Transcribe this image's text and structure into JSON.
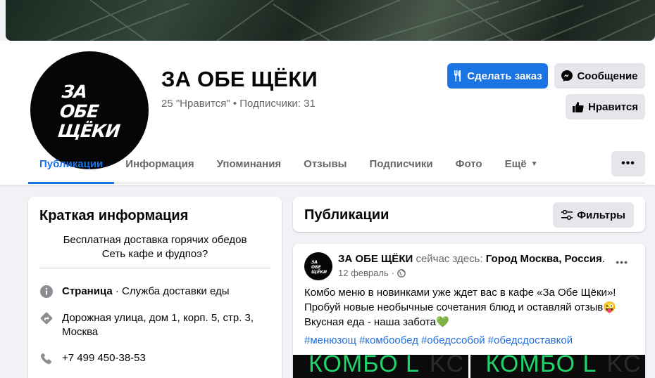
{
  "colors": {
    "accent": "#1b74e4",
    "secondary_btn": "#e4e6eb",
    "muted_text": "#65676b",
    "hashtag": "#216fdb",
    "combo_green": "#22d36b"
  },
  "page": {
    "logo_lines": [
      "ЗА",
      "ОБЕ",
      "ЩЁКИ"
    ],
    "name": "ЗА ОБЕ ЩЁКИ",
    "stats": "25 \"Нравится\" • Подписчики: 31"
  },
  "actions": {
    "order_label": "Сделать заказ",
    "message_label": "Сообщение",
    "like_label": "Нравится"
  },
  "tabs": [
    {
      "label": "Публикации"
    },
    {
      "label": "Информация"
    },
    {
      "label": "Упоминания"
    },
    {
      "label": "Отзывы"
    },
    {
      "label": "Подписчики"
    },
    {
      "label": "Фото"
    },
    {
      "label": "Ещё"
    }
  ],
  "more_menu_label": "•••",
  "intro": {
    "title": "Краткая информация",
    "description_line1": "Бесплатная доставка горячих обедов",
    "description_line2": "Сеть кафе и фудпоэ?",
    "category_prefix": "Страница",
    "category": " · Служба доставки еды",
    "address": "Дорожная улица, дом 1, корп. 5, стр. 3, Москва",
    "phone": "+7 499 450-38-53",
    "icons": [
      "info-icon",
      "directions-icon",
      "phone-icon"
    ]
  },
  "publications": {
    "title": "Публикации",
    "filter_label": "Фильтры"
  },
  "post": {
    "avatar_lines": [
      "ЗА",
      "ОБЕ",
      "ЩЁКИ"
    ],
    "author": "ЗА ОБЕ ЩЁКИ",
    "checkin_text": " сейчас здесь: ",
    "place": "Город Москва, Россия",
    "place_suffix": ".",
    "date": "12 февраль",
    "date_sep": "·",
    "more": "•••",
    "text_line1": "Комбо меню в новинками уже ждет вас в кафе «За Обе Щёки»!",
    "text_line2": "Пробуй новые необычные сочетания блюд и оставляй отзыв😜",
    "text_line3": "Вкусная еда - наша забота💚",
    "hashtags": [
      "#менюзощ",
      "#комбообед",
      "#обедссобой",
      "#обедсдоставкой"
    ],
    "image_text": "КОМБО L",
    "image_ghost": "KC"
  }
}
